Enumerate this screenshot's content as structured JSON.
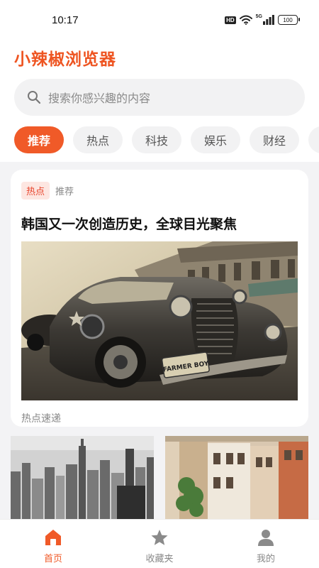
{
  "status_bar": {
    "time": "10:17",
    "hd": "HD",
    "network": "5G",
    "battery": "100"
  },
  "app": {
    "title": "小辣椒浏览器",
    "accent_color": "#f05a28"
  },
  "search": {
    "placeholder": "搜索你感兴趣的内容",
    "icon": "search-icon"
  },
  "tabs": [
    {
      "label": "推荐",
      "active": true
    },
    {
      "label": "热点",
      "active": false
    },
    {
      "label": "科技",
      "active": false
    },
    {
      "label": "娱乐",
      "active": false
    },
    {
      "label": "财经",
      "active": false
    },
    {
      "label": "",
      "active": false
    }
  ],
  "feed": {
    "featured": {
      "tag_primary": "热点",
      "tag_secondary": "推荐",
      "title": "韩国又一次创造历史，全球目光聚焦",
      "plate_text": "FARMER BOY",
      "source": "热点速递"
    }
  },
  "bottom_nav": [
    {
      "label": "首页",
      "icon": "home-icon",
      "active": true
    },
    {
      "label": "收藏夹",
      "icon": "star-icon",
      "active": false
    },
    {
      "label": "我的",
      "icon": "user-icon",
      "active": false
    }
  ]
}
